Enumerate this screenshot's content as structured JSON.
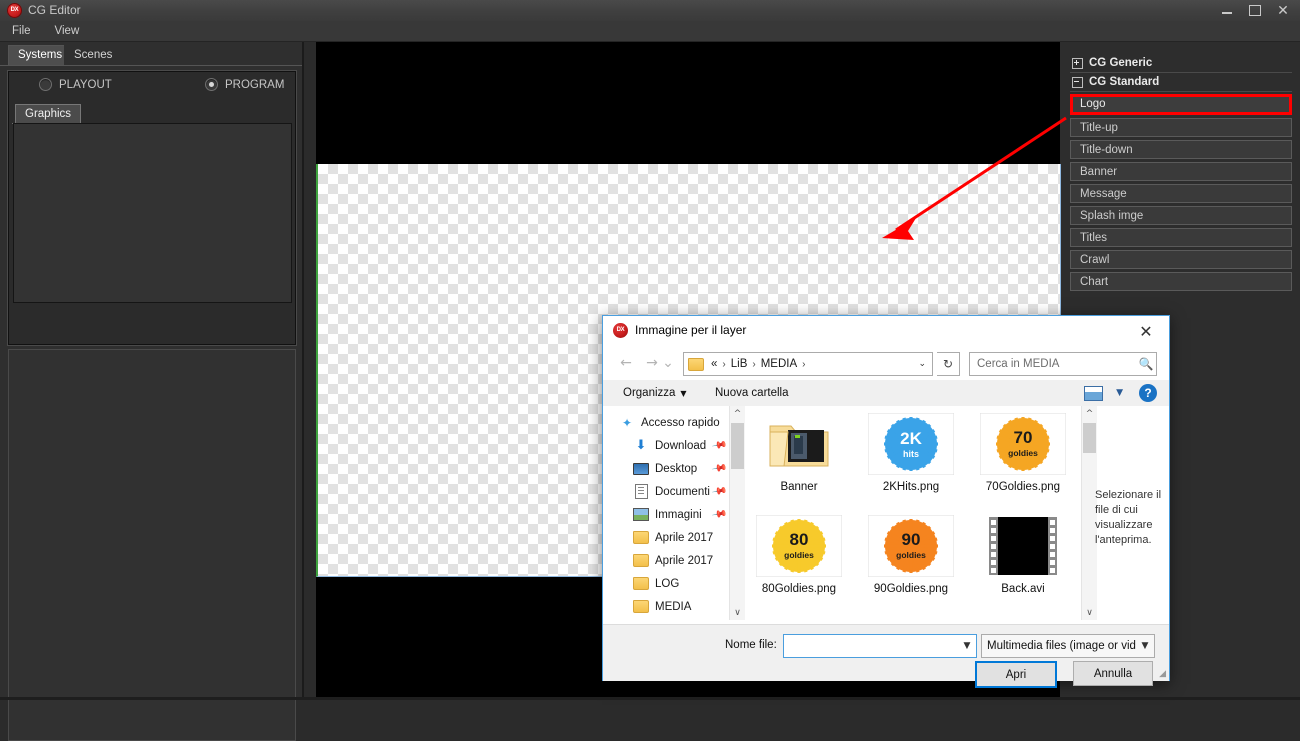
{
  "window": {
    "title": "CG Editor",
    "icon": "dx-logo-icon",
    "icon_text": "DX",
    "controls": {
      "minimize": "minimize-icon",
      "maximize": "maximize-icon",
      "close": "close-icon"
    }
  },
  "menubar": {
    "items": [
      "File",
      "View"
    ]
  },
  "left_panel": {
    "tabs": [
      {
        "label": "Systems",
        "active": true
      },
      {
        "label": "Scenes",
        "active": false
      }
    ],
    "radios": [
      {
        "label": "PLAYOUT",
        "selected": false
      },
      {
        "label": "PROGRAM",
        "selected": true
      }
    ],
    "inner_tabs": [
      {
        "label": "Graphics",
        "active": true
      }
    ]
  },
  "cg_panel": {
    "groups": [
      {
        "label": "CG Generic",
        "expanded": false,
        "toggle": "plus"
      },
      {
        "label": "CG Standard",
        "expanded": true,
        "toggle": "minus"
      }
    ],
    "items": [
      {
        "label": "Logo",
        "selected": true
      },
      {
        "label": "Title-up",
        "selected": false
      },
      {
        "label": "Title-down",
        "selected": false
      },
      {
        "label": "Banner",
        "selected": false
      },
      {
        "label": "Message",
        "selected": false
      },
      {
        "label": "Splash imge",
        "selected": false
      },
      {
        "label": "Titles",
        "selected": false
      },
      {
        "label": "Crawl",
        "selected": false
      },
      {
        "label": "Chart",
        "selected": false
      }
    ],
    "highlight_color": "#ff0000"
  },
  "annotation": {
    "type": "arrow",
    "color": "#ff0000"
  },
  "dialog": {
    "title": "Immagine per il layer",
    "icon_text": "DX",
    "close_label": "✕",
    "nav": {
      "back": "←",
      "forward": "→",
      "recent": "⌄",
      "up": "↑",
      "refresh": "↻",
      "breadcrumb": [
        "«",
        "LiB",
        "MEDIA"
      ],
      "separator": "›",
      "dropdown": "⌄"
    },
    "search": {
      "placeholder": "Cerca in MEDIA",
      "value": "",
      "icon": "search-icon"
    },
    "toolbar": {
      "organize": "Organizza",
      "new_folder": "Nuova cartella",
      "view_icon": "view-layout-icon",
      "view_dropdown": "▼",
      "help": "?"
    },
    "sidebar": [
      {
        "label": "Accesso rapido",
        "icon": "star-icon",
        "pinned": false,
        "indent": 0
      },
      {
        "label": "Download",
        "icon": "download-icon",
        "pinned": true,
        "indent": 1
      },
      {
        "label": "Desktop",
        "icon": "desktop-icon",
        "pinned": true,
        "indent": 1
      },
      {
        "label": "Documenti",
        "icon": "document-icon",
        "pinned": true,
        "indent": 1
      },
      {
        "label": "Immagini",
        "icon": "pictures-icon",
        "pinned": true,
        "indent": 1
      },
      {
        "label": "Aprile 2017",
        "icon": "folder-icon",
        "pinned": false,
        "indent": 1
      },
      {
        "label": "Aprile 2017",
        "icon": "folder-icon",
        "pinned": false,
        "indent": 1
      },
      {
        "label": "LOG",
        "icon": "folder-icon",
        "pinned": false,
        "indent": 1
      },
      {
        "label": "MEDIA",
        "icon": "folder-icon",
        "pinned": false,
        "indent": 1
      }
    ],
    "files": [
      {
        "name": "Banner",
        "kind": "folder"
      },
      {
        "name": "2KHits.png",
        "kind": "image",
        "badge_top": "2K",
        "badge_bottom": "hits",
        "badge_color": "#3aa3e8"
      },
      {
        "name": "70Goldies.png",
        "kind": "image",
        "badge_top": "70",
        "badge_bottom": "goldies",
        "badge_color": "#f5a623"
      },
      {
        "name": "80Goldies.png",
        "kind": "image",
        "badge_top": "80",
        "badge_bottom": "goldies",
        "badge_color": "#f7ca2b"
      },
      {
        "name": "90Goldies.png",
        "kind": "image",
        "badge_top": "90",
        "badge_bottom": "goldies",
        "badge_color": "#f5841f"
      },
      {
        "name": "Back.avi",
        "kind": "video"
      }
    ],
    "preview_text": "Selezionare il file di cui visualizzare l'anteprima.",
    "footer": {
      "filename_label": "Nome file:",
      "filename_value": "",
      "filetype_value": "Multimedia files (image or vide",
      "open_button": "Apri",
      "cancel_button": "Annulla"
    }
  }
}
